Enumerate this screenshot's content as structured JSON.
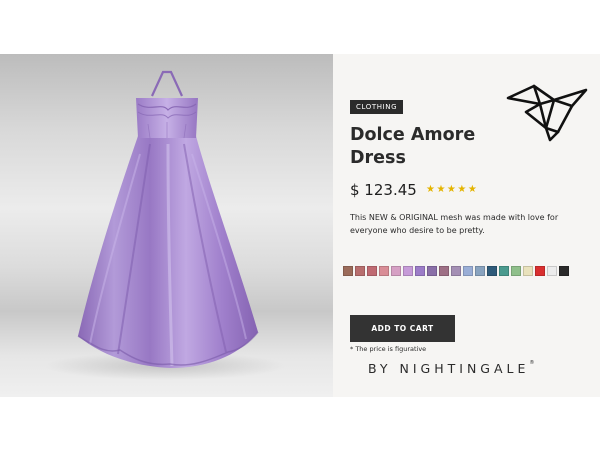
{
  "product": {
    "category": "CLOTHING",
    "title_line1": "Dolce Amore",
    "title_line2": "Dress",
    "price": "$ 123.45",
    "rating": "★★★★★",
    "description": "This NEW & ORIGINAL mesh was made with love for everyone who desire to be pretty."
  },
  "colors": {
    "accent": "#2b2b2b",
    "star": "#e4b400",
    "dress": "#a98bd1"
  },
  "swatches": [
    "#9b6b5a",
    "#b86e6e",
    "#c06a72",
    "#d98d96",
    "#d6a0c4",
    "#c69bd8",
    "#9c7cc8",
    "#8a6fa8",
    "#9e6f85",
    "#a48fb4",
    "#9aaed6",
    "#89a3bf",
    "#2f5b7a",
    "#4a9a8e",
    "#8fbf8a",
    "#e9e2bc",
    "#d92f2f",
    "#ececec",
    "#2a2a2a"
  ],
  "cart": {
    "button_label": "ADD TO CART",
    "price_note": "* The price is figurative"
  },
  "brand": {
    "signature": "BY NIGHTINGALE",
    "registered": "®",
    "logo_icon": "origami-bird-icon"
  }
}
